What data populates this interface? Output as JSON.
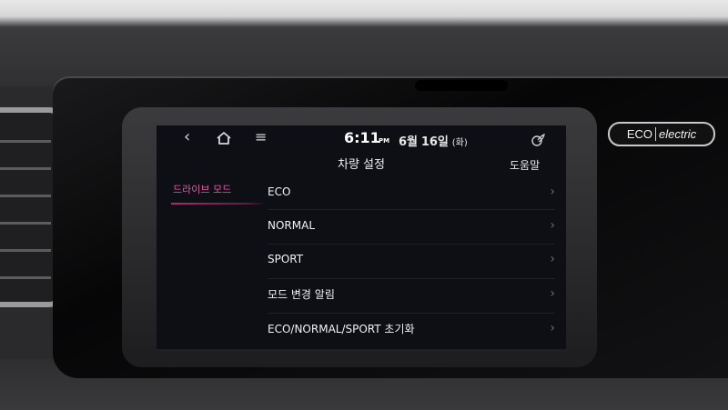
{
  "status_bar": {
    "time": "6:11",
    "ampm": "PM",
    "date_month": "6월",
    "date_day": "16일",
    "date_weekday": "(화)"
  },
  "header": {
    "title": "차량 설정",
    "help_label": "도움말"
  },
  "sidebar": {
    "items": [
      {
        "label": "드라이브 모드",
        "selected": true
      }
    ]
  },
  "menu": {
    "items": [
      {
        "label": "ECO"
      },
      {
        "label": "NORMAL"
      },
      {
        "label": "SPORT"
      },
      {
        "label": "모드 변경 알림"
      },
      {
        "label": "ECO/NORMAL/SPORT 초기화"
      }
    ]
  },
  "badge": {
    "part1": "ECO",
    "part2": "electric"
  },
  "colors": {
    "accent": "#e05aa8",
    "screen_bg": "#0d0f14"
  },
  "icons": {
    "back": "back-arrow-icon",
    "home": "home-icon",
    "menu": "menu-icon",
    "status": "leaf-status-icon",
    "chevron": "chevron-right-icon"
  }
}
